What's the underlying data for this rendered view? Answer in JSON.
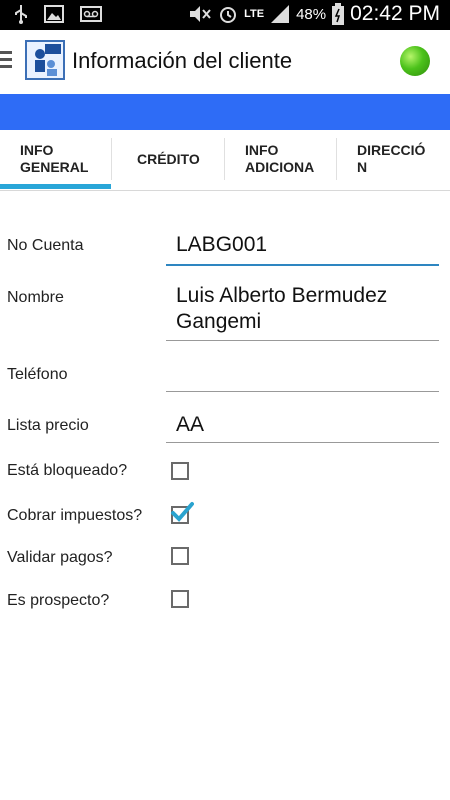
{
  "statusbar": {
    "icons": [
      "usb-icon",
      "image-icon",
      "voicemail-icon",
      "mute-icon",
      "alarm-icon",
      "lte-icon",
      "signal-icon",
      "battery-icon"
    ],
    "lte": "LTE",
    "battery": "48%",
    "time": "02:42 PM"
  },
  "header": {
    "title": "Información del cliente",
    "status_color": "#4cc21b"
  },
  "colors": {
    "accent_bar": "#2e6cf6",
    "tab_indicator": "#29a6d8"
  },
  "tabs": [
    {
      "label": "INFO\nGENERAL",
      "selected": true
    },
    {
      "label": "CRÉDITO",
      "selected": false
    },
    {
      "label": "INFO\nADICIONA",
      "selected": false
    },
    {
      "label": "DIRECCIÓ\nN",
      "selected": false
    }
  ],
  "form": {
    "account": {
      "label": "No Cuenta",
      "value": "LABG001"
    },
    "name": {
      "label": "Nombre",
      "value": "Luis Alberto Bermudez Gangemi"
    },
    "phone": {
      "label": "Teléfono",
      "value": ""
    },
    "price_list": {
      "label": "Lista precio",
      "value": "AA"
    },
    "blocked": {
      "label": "Está bloqueado?",
      "checked": false
    },
    "charge_taxes": {
      "label": "Cobrar impuestos?",
      "checked": true
    },
    "validate_payments": {
      "label": "Validar pagos?",
      "checked": false
    },
    "prospect": {
      "label": "Es prospecto?",
      "checked": false
    }
  }
}
